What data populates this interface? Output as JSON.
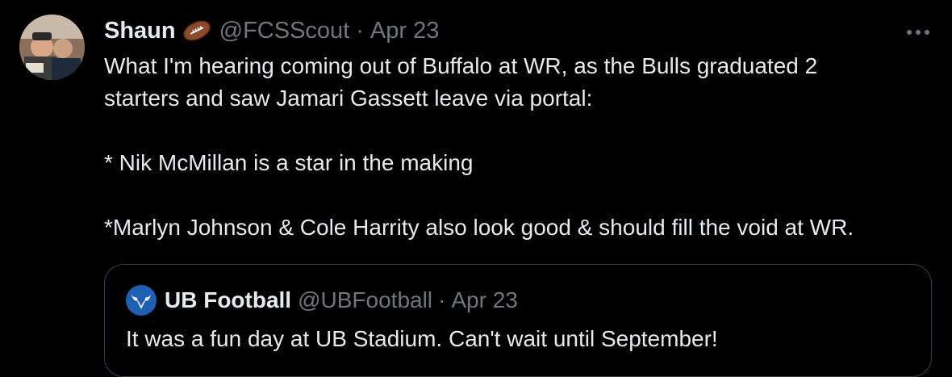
{
  "tweet": {
    "display_name": "Shaun",
    "name_emoji": "american-football-emoji",
    "handle": "@FCSScout",
    "separator": "·",
    "date": "Apr 23",
    "more_icon": "more-options-icon",
    "lines": [
      "What I'm hearing coming out of Buffalo at WR, as the Bulls graduated 2",
      "starters and saw Jamari Gassett leave via portal:",
      "* Nik McMillan is a star in the making",
      "*Marlyn Johnson & Cole Harrity also look good & should fill the void at WR."
    ]
  },
  "quote": {
    "display_name": "UB Football",
    "handle": "@UBFootball",
    "separator": "·",
    "date": "Apr 23",
    "text": "It was a fun day at UB Stadium. Can't wait until September!"
  },
  "colors": {
    "background": "#000000",
    "primary_text": "#e7e9ea",
    "secondary_text": "#71767b",
    "border": "#3a3e42"
  }
}
